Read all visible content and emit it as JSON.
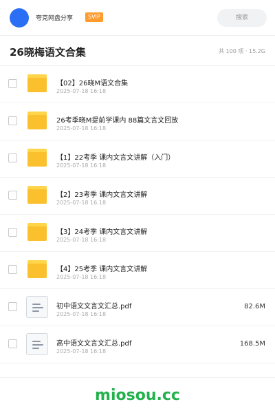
{
  "header": {
    "account_name": "夸克网盘分享",
    "vip_label": "SVIP",
    "search_placeholder": "搜索"
  },
  "folder": {
    "title": "26晓梅语文合集",
    "stats": "共 100 项 · 15.2G"
  },
  "files": [
    {
      "icon": "folder-icon",
      "name": "【02】26晓M语文合集",
      "date": "2025-07-18 16:18",
      "size": ""
    },
    {
      "icon": "folder-icon",
      "name": "26考季晓M提前学课内  88篇文言文回放",
      "date": "2025-07-18 16:18",
      "size": ""
    },
    {
      "icon": "folder-icon",
      "name": "【1】22考季 课内文言文讲解（入门）",
      "date": "2025-07-18 16:18",
      "size": ""
    },
    {
      "icon": "folder-icon",
      "name": "【2】23考季 课内文言文讲解",
      "date": "2025-07-18 16:18",
      "size": ""
    },
    {
      "icon": "folder-icon",
      "name": "【3】24考季 课内文言文讲解",
      "date": "2025-07-18 16:18",
      "size": ""
    },
    {
      "icon": "folder-icon",
      "name": "【4】25考季 课内文言文讲解",
      "date": "2025-07-18 16:18",
      "size": ""
    },
    {
      "icon": "document-icon",
      "name": "初中语文文言文汇总.pdf",
      "date": "2025-07-18 16:18",
      "size": "82.6M"
    },
    {
      "icon": "document-icon",
      "name": "高中语文文言文汇总.pdf",
      "date": "2025-07-18 16:18",
      "size": "168.5M"
    }
  ],
  "footer": {
    "watermark": "miosou.cc"
  },
  "colors": {
    "accent": "#2b6ff5",
    "vip": "#ff9b2f",
    "folder": "#fbc02d",
    "watermark": "#22b14c"
  }
}
